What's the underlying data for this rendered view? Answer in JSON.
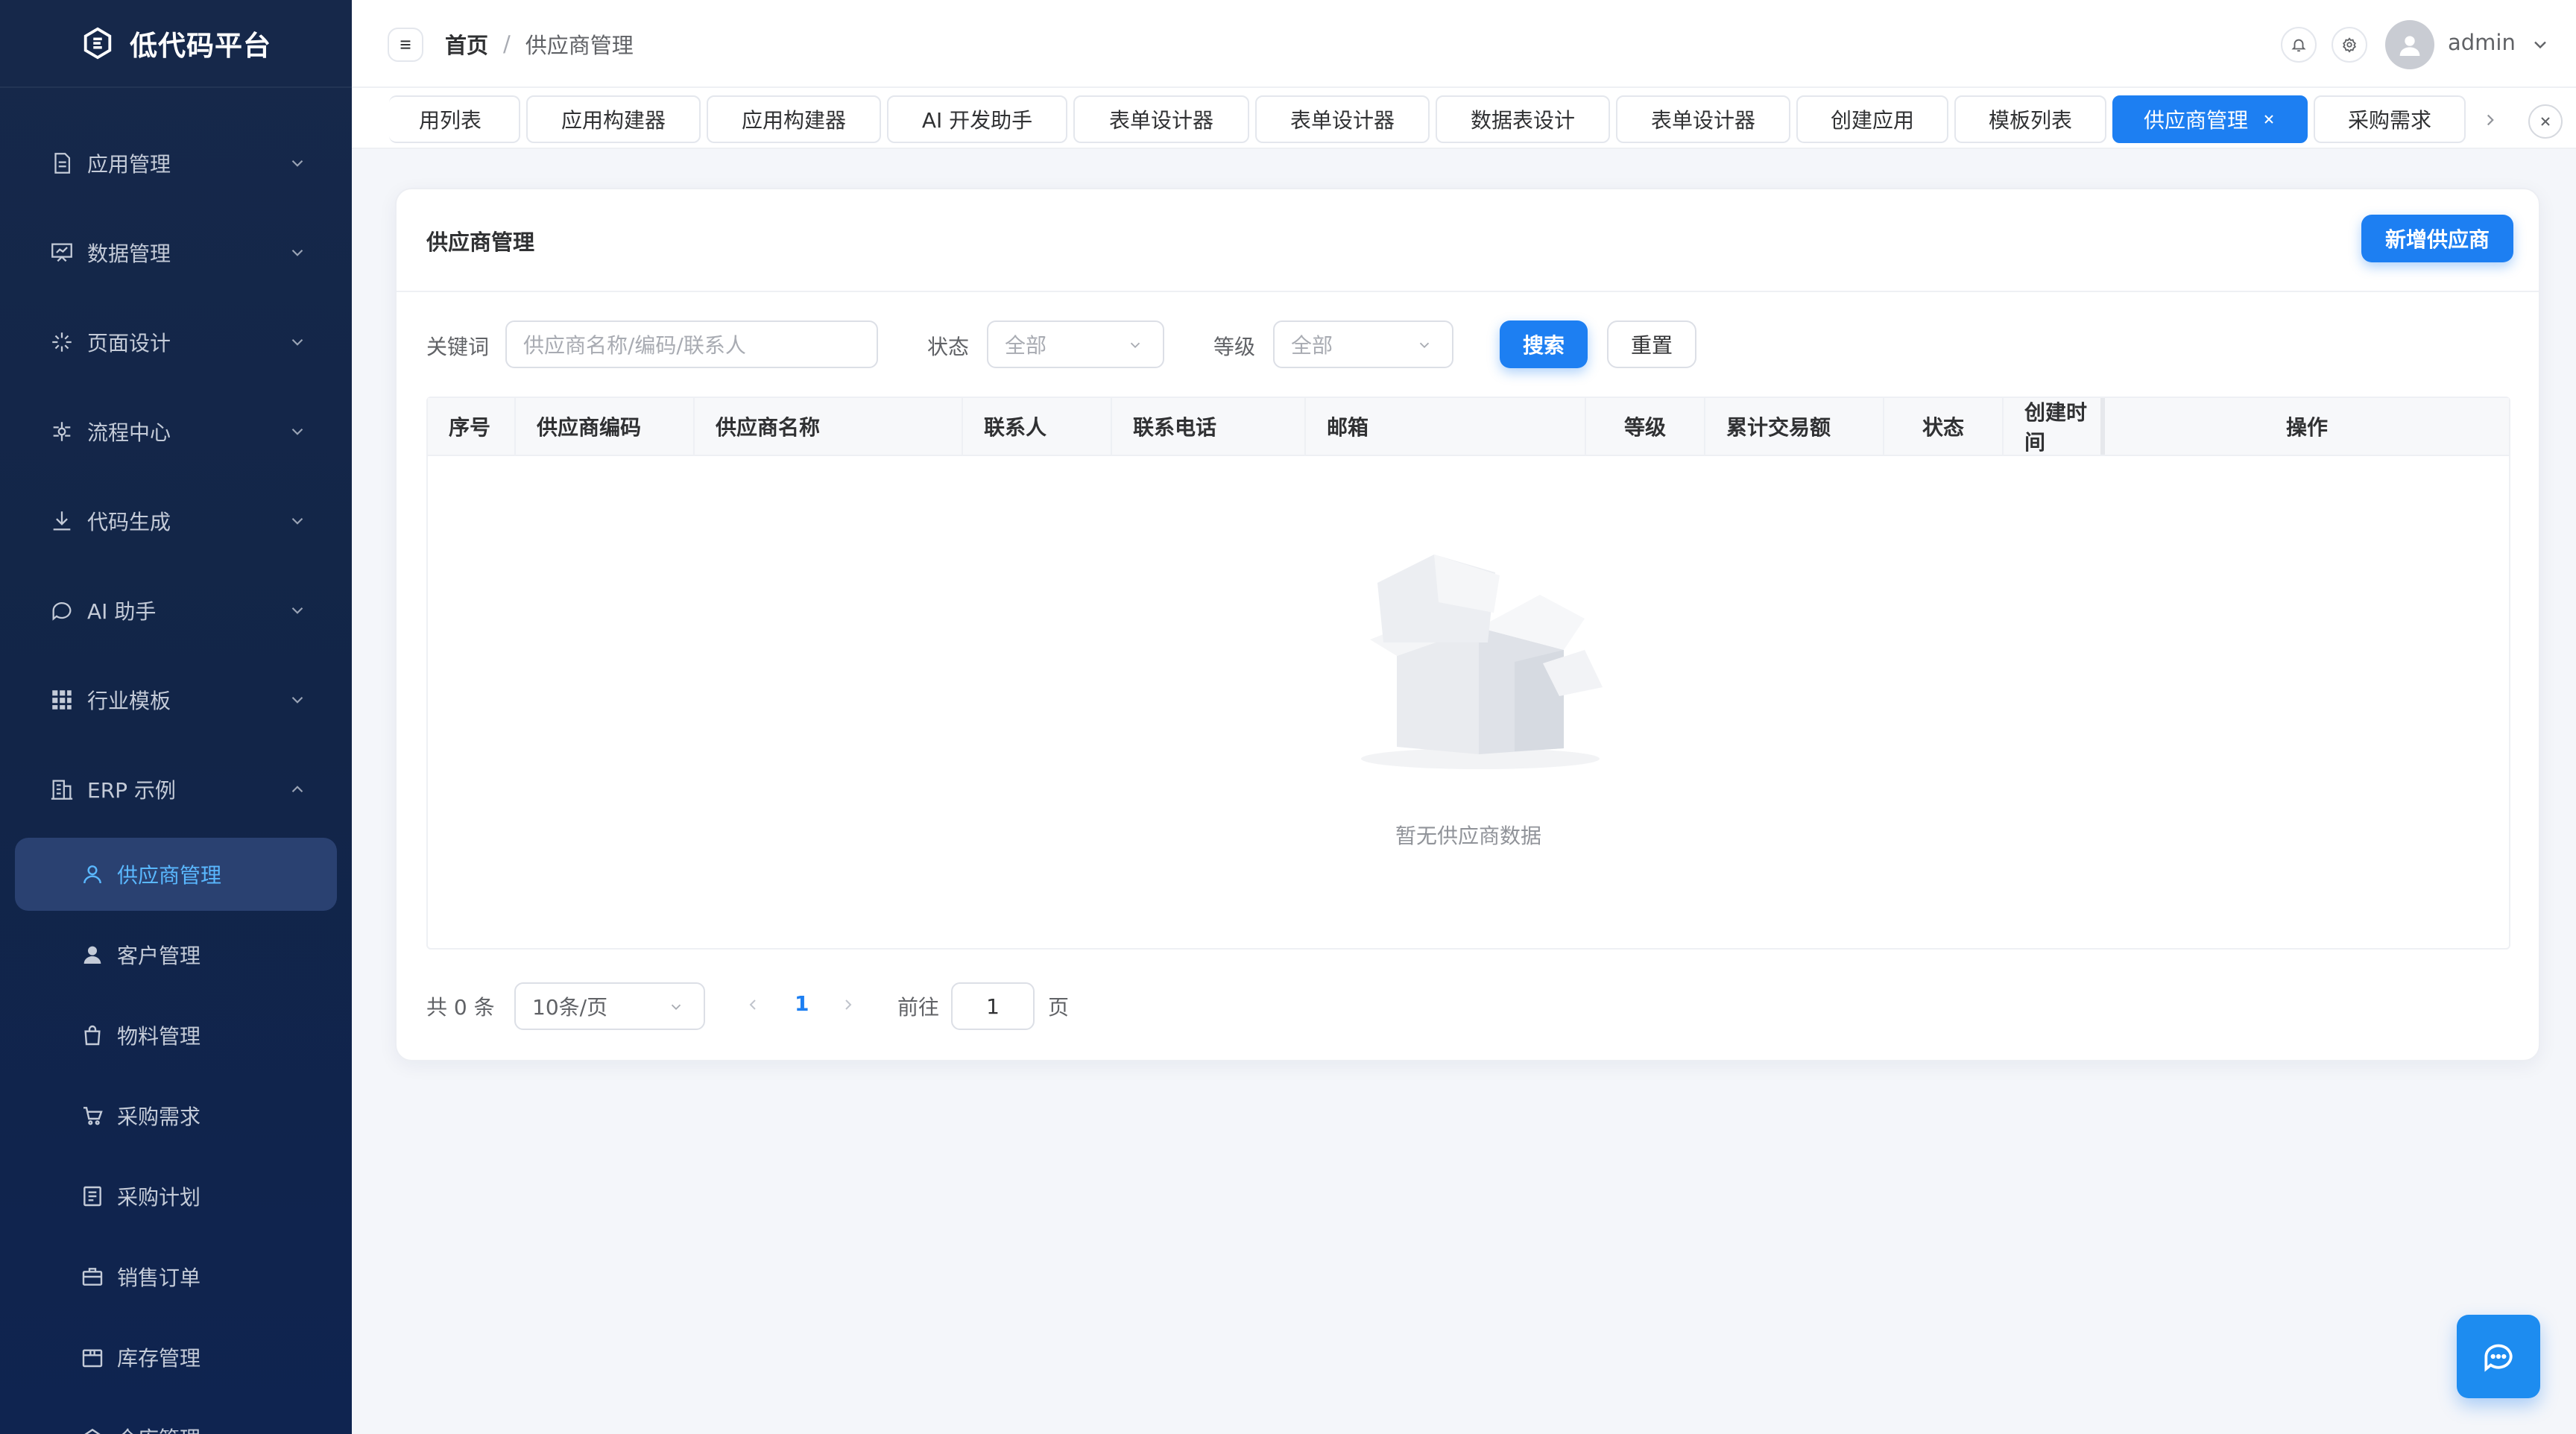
{
  "app": {
    "title": "低代码平台"
  },
  "colors": {
    "accent": "#1d7ff2",
    "sidebar_bg": "#122548",
    "active_submenu_text": "#5ab8ff"
  },
  "sidebar": {
    "menus": [
      {
        "label": "应用管理",
        "icon": "document-icon"
      },
      {
        "label": "数据管理",
        "icon": "data-board-icon"
      },
      {
        "label": "页面设计",
        "icon": "sparkle-icon"
      },
      {
        "label": "流程中心",
        "icon": "flow-icon"
      },
      {
        "label": "代码生成",
        "icon": "download-icon"
      },
      {
        "label": "AI 助手",
        "icon": "chat-icon"
      },
      {
        "label": "行业模板",
        "icon": "grid-icon"
      },
      {
        "label": "ERP 示例",
        "icon": "building-icon"
      }
    ],
    "submenu": [
      {
        "label": "供应商管理",
        "icon": "user-outline-icon",
        "active": true
      },
      {
        "label": "客户管理",
        "icon": "user-solid-icon"
      },
      {
        "label": "物料管理",
        "icon": "bag-icon"
      },
      {
        "label": "采购需求",
        "icon": "cart-icon"
      },
      {
        "label": "采购计划",
        "icon": "list-icon"
      },
      {
        "label": "销售订单",
        "icon": "briefcase-icon"
      },
      {
        "label": "库存管理",
        "icon": "box-icon"
      },
      {
        "label": "仓库管理",
        "icon": "warehouse-icon"
      }
    ]
  },
  "header": {
    "breadcrumb": {
      "home": "首页",
      "separator": "/",
      "current": "供应商管理"
    },
    "username": "admin"
  },
  "tabs": [
    {
      "label": "用列表"
    },
    {
      "label": "应用构建器"
    },
    {
      "label": "应用构建器"
    },
    {
      "label": "AI 开发助手"
    },
    {
      "label": "表单设计器"
    },
    {
      "label": "表单设计器"
    },
    {
      "label": "数据表设计"
    },
    {
      "label": "表单设计器"
    },
    {
      "label": "创建应用"
    },
    {
      "label": "模板列表"
    },
    {
      "label": "供应商管理",
      "active": true,
      "closable": true
    },
    {
      "label": "采购需求"
    }
  ],
  "page": {
    "title": "供应商管理",
    "add_button": "新增供应商",
    "filters": {
      "keyword_label": "关键词",
      "keyword_placeholder": "供应商名称/编码/联系人",
      "status_label": "状态",
      "status_value": "全部",
      "level_label": "等级",
      "level_value": "全部",
      "search_button": "搜索",
      "reset_button": "重置"
    },
    "table": {
      "columns": [
        "序号",
        "供应商编码",
        "供应商名称",
        "联系人",
        "联系电话",
        "邮箱",
        "等级",
        "累计交易额",
        "状态",
        "创建时间",
        "操作"
      ],
      "rows": [],
      "empty_text": "暂无供应商数据"
    },
    "pagination": {
      "total_text": "共 0 条",
      "page_size": "10条/页",
      "current_page": "1",
      "goto_label": "前往",
      "goto_value": "1",
      "page_suffix": "页"
    }
  }
}
